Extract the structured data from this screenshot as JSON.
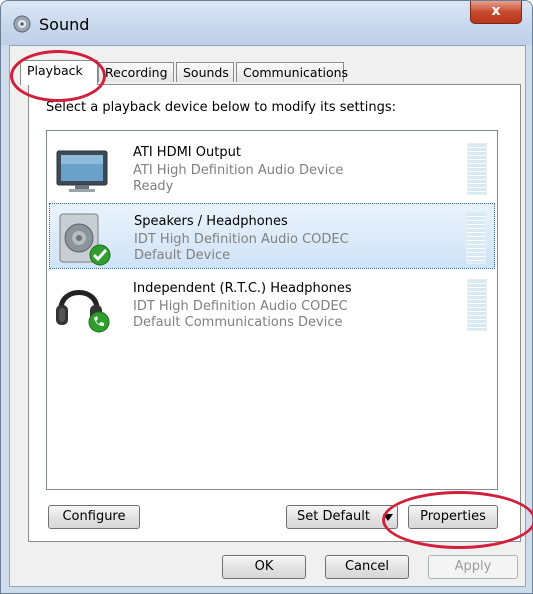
{
  "window": {
    "title": "Sound",
    "close_glyph": "x"
  },
  "tabs": [
    {
      "label": "Playback",
      "active": true
    },
    {
      "label": "Recording"
    },
    {
      "label": "Sounds"
    },
    {
      "label": "Communications"
    }
  ],
  "instruction": "Select a playback device below to modify its settings:",
  "devices": [
    {
      "name": "ATI HDMI Output",
      "driver": "ATI High Definition Audio Device",
      "status": "Ready",
      "icon": "monitor-icon"
    },
    {
      "name": "Speakers / Headphones",
      "driver": "IDT High Definition Audio CODEC",
      "status": "Default Device",
      "icon": "speaker-icon",
      "badge": "green-check-badge",
      "selected": true
    },
    {
      "name": "Independent (R.T.C.) Headphones",
      "driver": "IDT High Definition Audio CODEC",
      "status": "Default Communications Device",
      "icon": "headphones-icon",
      "badge": "green-phone-badge"
    }
  ],
  "buttons": {
    "configure": "Configure",
    "set_default": "Set Default",
    "properties": "Properties",
    "ok": "OK",
    "cancel": "Cancel",
    "apply": "Apply"
  },
  "colors": {
    "highlight": "#d21f3c",
    "selection": "#cfe3f7"
  }
}
